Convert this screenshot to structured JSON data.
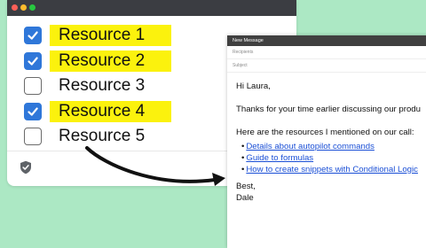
{
  "checklist": {
    "items": [
      {
        "label": "Resource 1",
        "checked": true,
        "highlighted": true
      },
      {
        "label": "Resource 2",
        "checked": true,
        "highlighted": true
      },
      {
        "label": "Resource 3",
        "checked": false,
        "highlighted": false
      },
      {
        "label": "Resource 4",
        "checked": true,
        "highlighted": true
      },
      {
        "label": "Resource 5",
        "checked": false,
        "highlighted": false
      }
    ],
    "footer_icon": "shield-check-icon"
  },
  "email": {
    "header_title": "New Message",
    "recipients_placeholder": "Recipients",
    "subject_placeholder": "Subject",
    "greeting": "Hi Laura,",
    "paragraph1": "Thanks for your time earlier discussing our produ",
    "paragraph2": "Here are the resources I mentioned on our call:",
    "links": [
      "Details about autopilot commands",
      "Guide to formulas",
      "How to create snippets with Conditional Logic"
    ],
    "signoff": "Best,",
    "signature": "Dale"
  },
  "colors": {
    "background": "#ace8c4",
    "checkbox_checked": "#2f77d9",
    "highlight": "#fbf20d",
    "link": "#1a4fd6"
  }
}
